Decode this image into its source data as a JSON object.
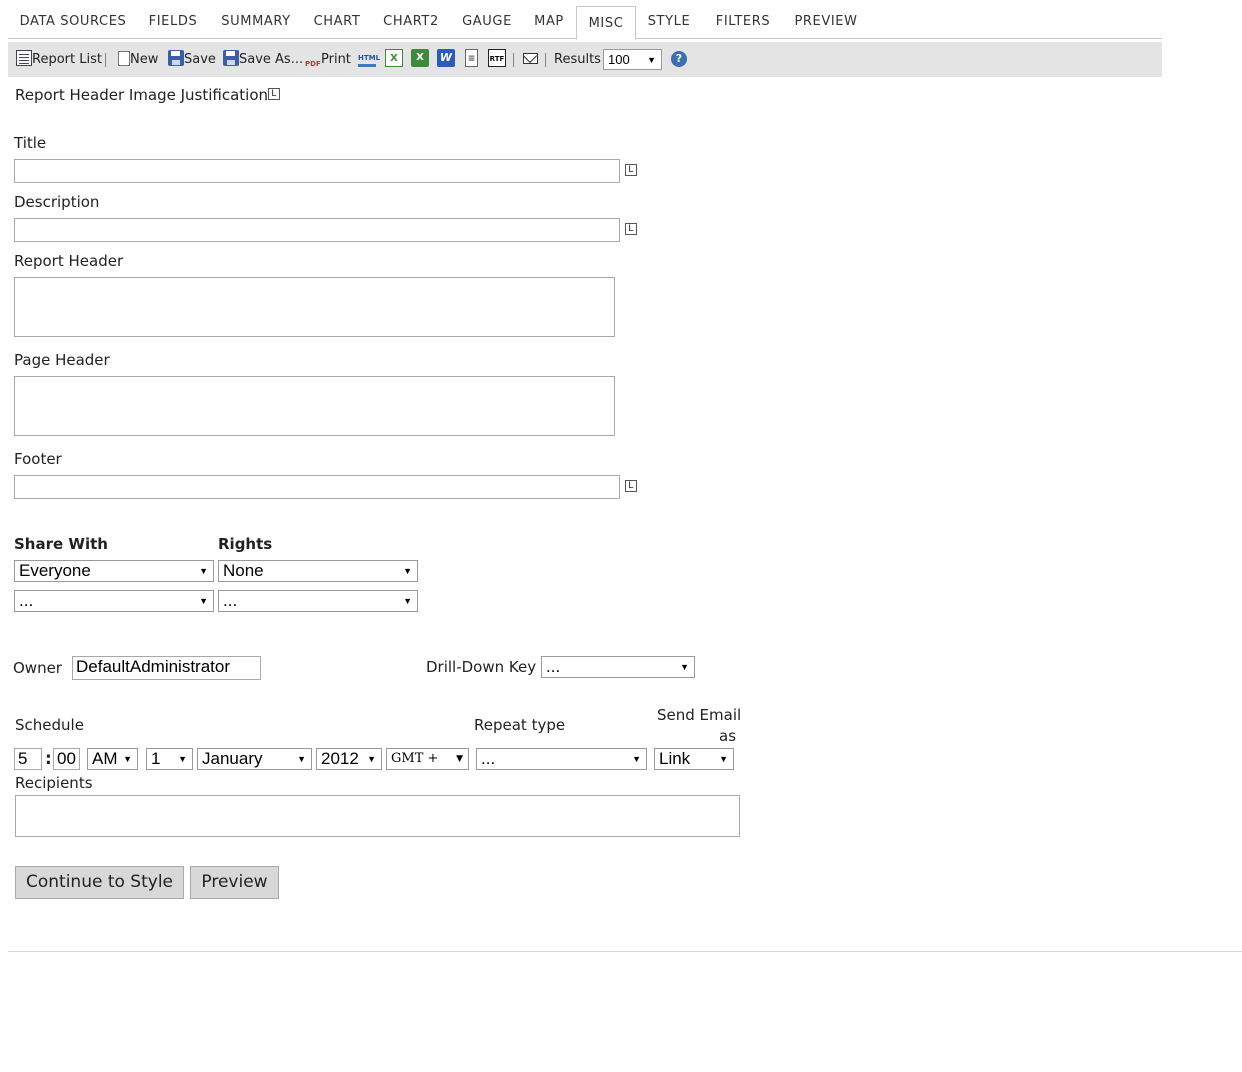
{
  "tabs": [
    "DATA SOURCES",
    "FIELDS",
    "SUMMARY",
    "CHART",
    "CHART2",
    "GAUGE",
    "MAP",
    "MISC",
    "STYLE",
    "FILTERS",
    "PREVIEW"
  ],
  "active_tab": "MISC",
  "toolbar": {
    "report_list": "Report List",
    "new": "New",
    "save": "Save",
    "save_as": "Save As...",
    "print": "Print",
    "results_label": "Results",
    "results_value": "100",
    "icons": [
      "pdf-print-icon",
      "html-export-icon",
      "excel-export-icon",
      "xlsx-export-icon",
      "word-export-icon",
      "page-icon",
      "rtf-export-icon",
      "email-icon",
      "help-icon"
    ]
  },
  "form": {
    "image_justification_label": "Report Header Image Justification:",
    "image_justification_value": "L",
    "title_label": "Title",
    "title_value": "",
    "title_justify": "L",
    "description_label": "Description",
    "description_value": "",
    "description_justify": "L",
    "report_header_label": "Report Header",
    "page_header_label": "Page Header",
    "footer_label": "Footer",
    "footer_value": "",
    "footer_justify": "L"
  },
  "sharing": {
    "share_with_label": "Share With",
    "rights_label": "Rights",
    "rows": [
      {
        "share_with": "Everyone",
        "rights": "None"
      },
      {
        "share_with": "...",
        "rights": "..."
      }
    ]
  },
  "owner": {
    "label": "Owner",
    "value": "DefaultAdministrator",
    "drilldown_label": "Drill-Down Key",
    "drilldown_value": "..."
  },
  "schedule": {
    "label": "Schedule",
    "hour": "5",
    "separator": ":",
    "minute": "00",
    "ampm": "AM",
    "day": "1",
    "month": "January",
    "year": "2012",
    "timezone": "GMT +",
    "repeat_type_label": "Repeat type",
    "repeat_type_value": "...",
    "send_email_label_line1": "Send Email",
    "send_email_label_line2": "as",
    "send_email_value": "Link",
    "recipients_label": "Recipients",
    "recipients_value": ""
  },
  "buttons": {
    "continue": "Continue to Style",
    "preview": "Preview"
  },
  "arrow_glyph": "▼"
}
